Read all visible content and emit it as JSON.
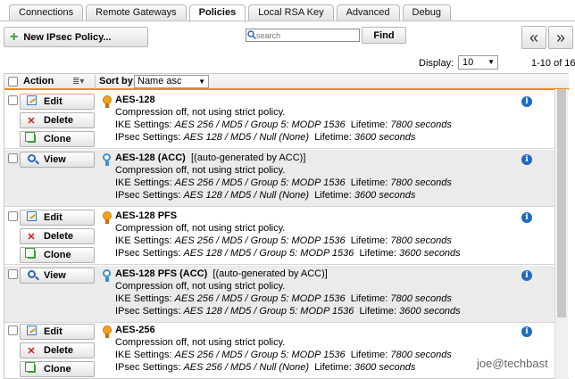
{
  "tabs": [
    {
      "label": "Connections"
    },
    {
      "label": "Remote Gateways"
    },
    {
      "label": "Policies"
    },
    {
      "label": "Local RSA Key"
    },
    {
      "label": "Advanced"
    },
    {
      "label": "Debug"
    }
  ],
  "active_tab": "Policies",
  "toolbar": {
    "new_label": "New IPsec Policy...",
    "search_placeholder": "search",
    "find_label": "Find",
    "prev_label": "«",
    "next_label": "»"
  },
  "pager": {
    "display_label": "Display:",
    "display_value": "10",
    "range": "1-10 of 16"
  },
  "table": {
    "action_header": "Action",
    "sort_label": "Sort by:",
    "sort_value": "Name asc"
  },
  "actions": {
    "edit": "Edit",
    "delete": "Delete",
    "clone": "Clone",
    "view": "View"
  },
  "policies": [
    {
      "name": "AES-128",
      "tag": "",
      "compression": "Compression off, not using strict policy.",
      "ike_label": "IKE Settings:",
      "ike": "AES 256 / MD5 / Group 5: MODP 1536",
      "ike_lifetime_label": "Lifetime:",
      "ike_lifetime": "7800 seconds",
      "ipsec_label": "IPsec Settings:",
      "ipsec": "AES 128 / MD5 / Null (None)",
      "ipsec_lifetime_label": "Lifetime:",
      "ipsec_lifetime": "3600 seconds"
    },
    {
      "name": "AES-128 (ACC)",
      "tag": "[(auto-generated by ACC)]",
      "compression": "Compression off, not using strict policy.",
      "ike_label": "IKE Settings:",
      "ike": "AES 256 / MD5 / Group 5: MODP 1536",
      "ike_lifetime_label": "Lifetime:",
      "ike_lifetime": "7800 seconds",
      "ipsec_label": "IPsec Settings:",
      "ipsec": "AES 128 / MD5 / Null (None)",
      "ipsec_lifetime_label": "Lifetime:",
      "ipsec_lifetime": "3600 seconds"
    },
    {
      "name": "AES-128 PFS",
      "tag": "",
      "compression": "Compression off, not using strict policy.",
      "ike_label": "IKE Settings:",
      "ike": "AES 256 / MD5 / Group 5: MODP 1536",
      "ike_lifetime_label": "Lifetime:",
      "ike_lifetime": "7800 seconds",
      "ipsec_label": "IPsec Settings:",
      "ipsec": "AES 128 / MD5 / Group 5: MODP 1536",
      "ipsec_lifetime_label": "Lifetime:",
      "ipsec_lifetime": "3600 seconds"
    },
    {
      "name": "AES-128 PFS (ACC)",
      "tag": "[(auto-generated by ACC)]",
      "compression": "Compression off, not using strict policy.",
      "ike_label": "IKE Settings:",
      "ike": "AES 256 / MD5 / Group 5: MODP 1536",
      "ike_lifetime_label": "Lifetime:",
      "ike_lifetime": "7800 seconds",
      "ipsec_label": "IPsec Settings:",
      "ipsec": "AES 128 / MD5 / Group 5: MODP 1536",
      "ipsec_lifetime_label": "Lifetime:",
      "ipsec_lifetime": "3600 seconds"
    },
    {
      "name": "AES-256",
      "tag": "",
      "compression": "Compression off, not using strict policy.",
      "ike_label": "IKE Settings:",
      "ike": "AES 256 / MD5 / Group 5: MODP 1536",
      "ike_lifetime_label": "Lifetime:",
      "ike_lifetime": "7800 seconds",
      "ipsec_label": "IPsec Settings:",
      "ipsec": "AES 256 / MD5 / Null (None)",
      "ipsec_lifetime_label": "Lifetime:",
      "ipsec_lifetime": "3600 seconds"
    }
  ],
  "watermark": "joe@techbast",
  "colors": {
    "accent_orange": "#ef8a1a",
    "info_blue": "#1f6bc1",
    "delete_red": "#d21a1a"
  }
}
